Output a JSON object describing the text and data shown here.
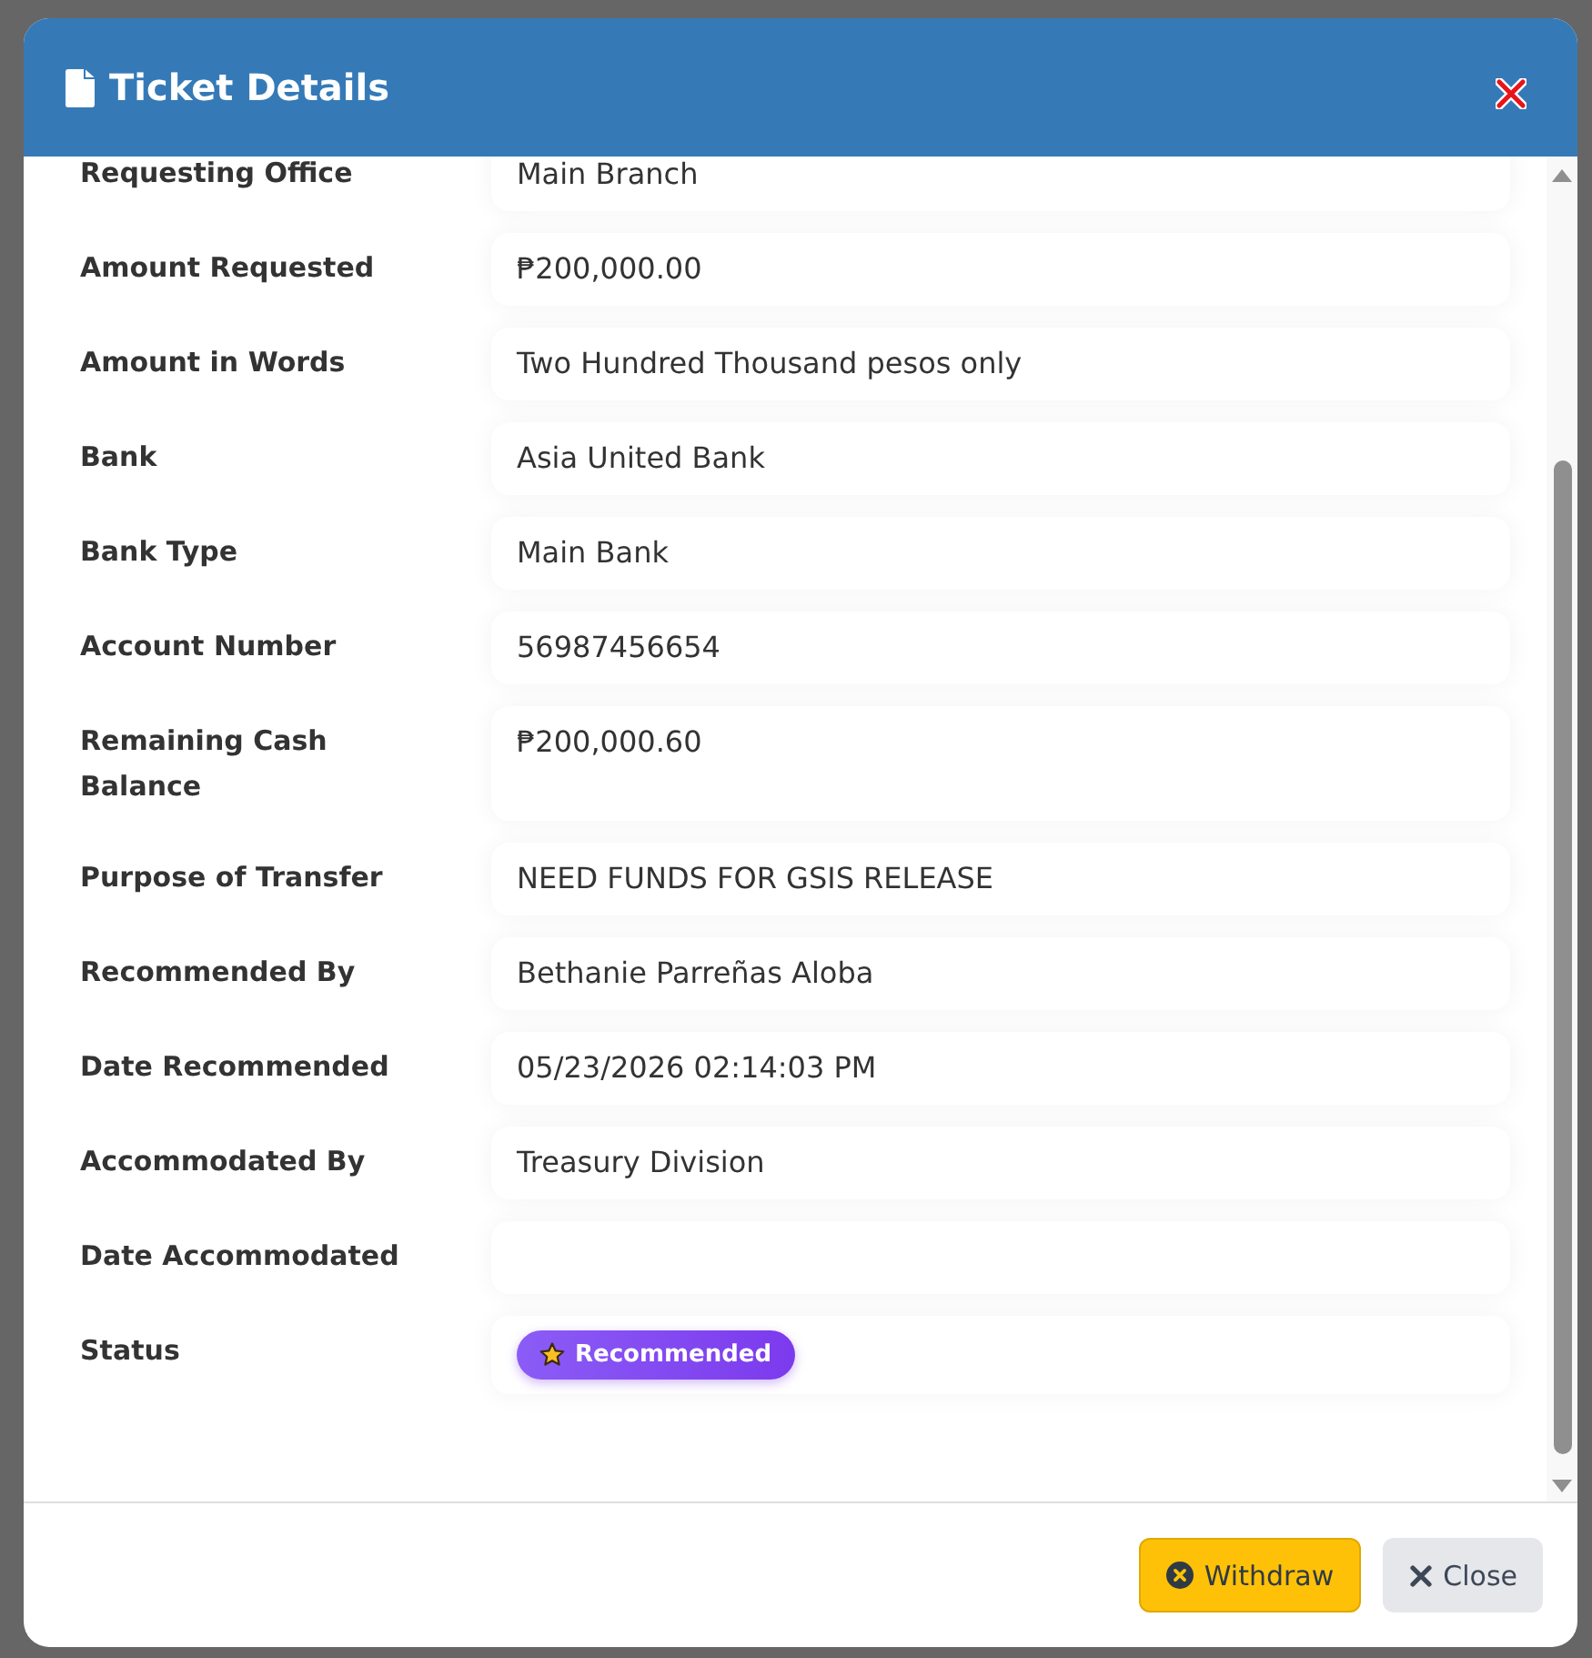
{
  "window": {
    "title": "Ticket Details"
  },
  "fields": [
    {
      "label": "Requesting Office",
      "kind": "text",
      "value": "Main Branch"
    },
    {
      "label": "Amount Requested",
      "kind": "text",
      "value": "₱200,000.00"
    },
    {
      "label": "Amount in Words",
      "kind": "text",
      "value": "Two Hundred Thousand pesos only"
    },
    {
      "label": "Bank",
      "kind": "text",
      "value": "Asia United Bank"
    },
    {
      "label": "Bank Type",
      "kind": "text",
      "value": "Main Bank"
    },
    {
      "label": "Account Number",
      "kind": "text",
      "value": "56987456654"
    },
    {
      "label": "Remaining Cash Balance",
      "kind": "text",
      "value": "₱200,000.60"
    },
    {
      "label": "Purpose of Transfer",
      "kind": "text",
      "value": "NEED FUNDS FOR GSIS RELEASE"
    },
    {
      "label": "Recommended By",
      "kind": "text",
      "value": "Bethanie Parreñas Aloba"
    },
    {
      "label": "Date Recommended",
      "kind": "text",
      "value": "05/23/2026 02:14:03 PM"
    },
    {
      "label": "Accommodated By",
      "kind": "text",
      "value": "Treasury Division"
    },
    {
      "label": "Date Accommodated",
      "kind": "text"
    },
    {
      "label": "Status",
      "kind": "badge",
      "value": "Recommended"
    }
  ],
  "buttons": [
    {
      "label": "Withdraw",
      "kind": "warning"
    },
    {
      "label": "Close",
      "kind": "secondary"
    }
  ]
}
